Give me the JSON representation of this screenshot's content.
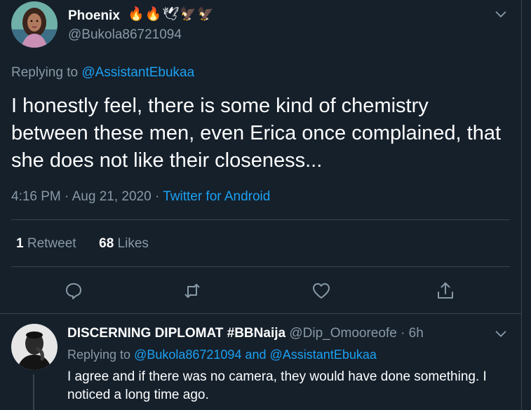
{
  "tweet": {
    "display_name": "Phoenix",
    "emoji_badges": "🔥🔥🕊🦅🦅",
    "handle": "@Bukola86721094",
    "replying_prefix": "Replying to ",
    "replying_to": "@AssistantEbukaa",
    "text": "I honestly feel, there is some kind of chemistry between these men, even Erica once complained, that she does not like their closeness...",
    "time": "4:16 PM",
    "date": "Aug 21, 2020",
    "separator": "·",
    "source": "Twitter for Android",
    "retweet_count": "1",
    "retweet_label": "Retweet",
    "like_count": "68",
    "like_label": "Likes"
  },
  "reply": {
    "display_name": "DISCERNING DIPLOMAT #BBNaija",
    "handle": "@Dip_Omooreofe",
    "separator": "·",
    "age": "6h",
    "replying_prefix": "Replying to ",
    "replying_to_1": "@Bukola86721094",
    "and_word": " and ",
    "replying_to_2": "@AssistantEbukaa",
    "text": "I agree and if there was no camera, they would have done something. I noticed a long time ago."
  },
  "icons": [
    "chevron-down-icon",
    "reply-icon",
    "retweet-icon",
    "like-icon",
    "share-icon"
  ],
  "colors": {
    "background": "#15202b",
    "link": "#1da1f2",
    "muted": "#8899a6",
    "divider": "#38444d",
    "text": "#ffffff"
  }
}
